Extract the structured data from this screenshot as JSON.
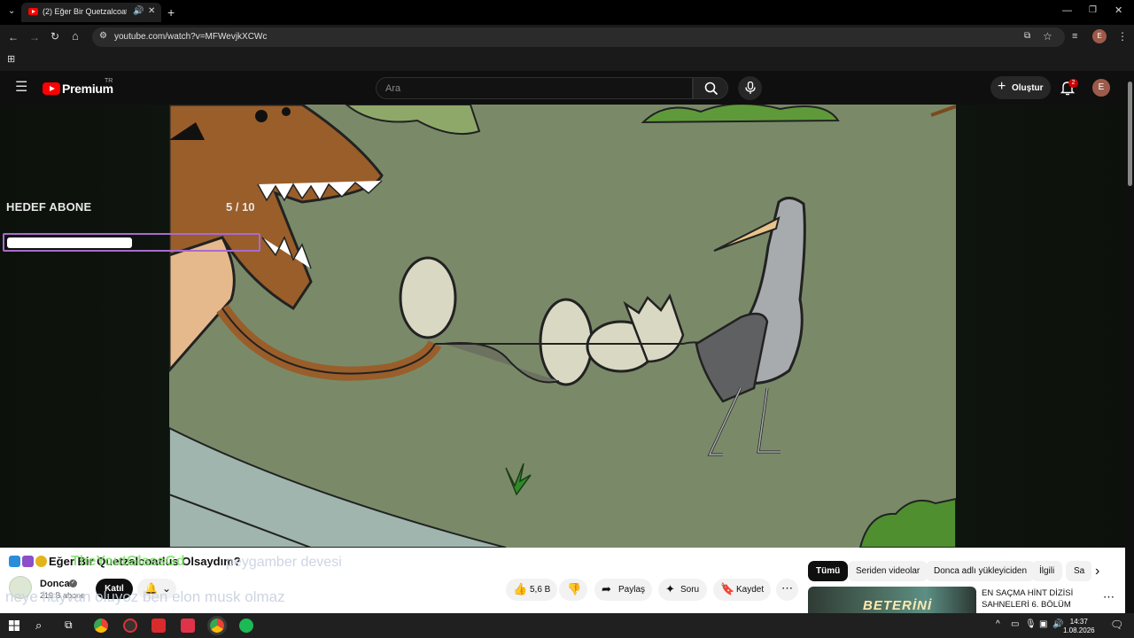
{
  "browser": {
    "tab_title": "(2) Eğer Bir Quetzalcoatlus",
    "url": "youtube.com/watch?v=MFWevjkXCWc",
    "profile_initial": "E"
  },
  "youtube": {
    "logo_text": "Premium",
    "logo_region": "TR",
    "search_placeholder": "Ara",
    "create_label": "Oluştur",
    "notification_count": "2",
    "avatar_initial": "E"
  },
  "overlay": {
    "title": "HEDEF ABONE",
    "count": "5 / 10",
    "progress_fraction": 0.5
  },
  "video": {
    "title": "Eğer Bir Quetzalcoatlus Olsaydım?",
    "channel": "Donca",
    "subscribers": "219 B abone",
    "join_label": "Katıl",
    "likes": "5,6 B",
    "share_label": "Paylaş",
    "ask_label": "Soru",
    "save_label": "Kaydet"
  },
  "chat_overlay": {
    "line1_name": "TheYoutGlassGd",
    "line1_text": "peygamber devesi",
    "line2_text": "neye hayvan oluyoz ben elon musk olmaz"
  },
  "sidebar": {
    "chips": [
      "Tümü",
      "Seriden videolar",
      "Donca adlı yükleyiciden",
      "İlgili",
      "Sa"
    ],
    "recommendation_title": "EN SAÇMA HİNT DİZİSİ SAHNELERİ 6. BÖLÜM",
    "recommendation_thumb_text": "BETERİNİ"
  },
  "taskbar": {
    "time": "14:37",
    "date": "1.08.2026"
  },
  "colors": {
    "youtube_red": "#ff0000",
    "progress_border": "#a96ad0",
    "chat_name_green": "#7ee06a"
  }
}
